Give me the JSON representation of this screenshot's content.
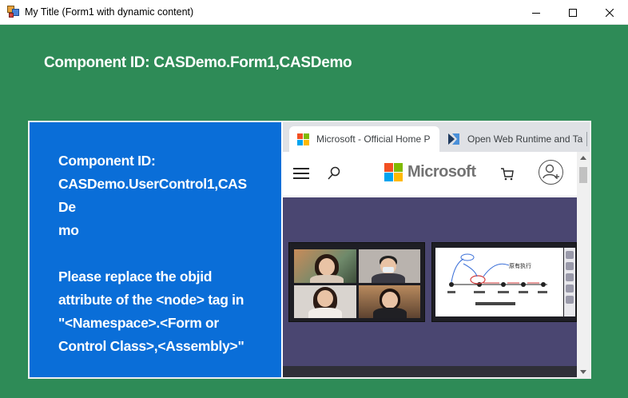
{
  "window": {
    "title": "My Title (Form1 with dynamic content)",
    "controls": [
      "minimize-icon",
      "maximize-icon",
      "close-icon"
    ]
  },
  "form": {
    "heading": "Component ID: CASDemo.Form1,CASDemo",
    "background_color": "#2e8b57"
  },
  "user_control": {
    "background_color": "#0a6ed8",
    "id_label": "Component ID:",
    "id_value_line1": "CASDemo.UserControl1,CASDe",
    "id_value_line2": "mo",
    "instruction_line1": "Please replace the objid",
    "instruction_line2": "attribute of the <node> tag in",
    "instruction_line3": "\"<Namespace>.<Form or",
    "instruction_line4": "Control Class>,<Assembly>\""
  },
  "browser": {
    "tabs": [
      {
        "label": "Microsoft - Official Home P",
        "icon": "microsoft-logo-icon",
        "active": true
      },
      {
        "label": "Open Web Runtime and Ta",
        "icon": "open-web-runtime-icon",
        "active": false
      }
    ],
    "site": {
      "brand": "Microsoft",
      "icons": [
        "menu-icon",
        "search-icon",
        "cart-icon",
        "account-icon"
      ],
      "hero_color": "#4a4671"
    },
    "whiteboard_note": "原有执行"
  },
  "colors": {
    "ms_red": "#f25022",
    "ms_green": "#7fba00",
    "ms_blue": "#00a4ef",
    "ms_yellow": "#ffb900"
  }
}
